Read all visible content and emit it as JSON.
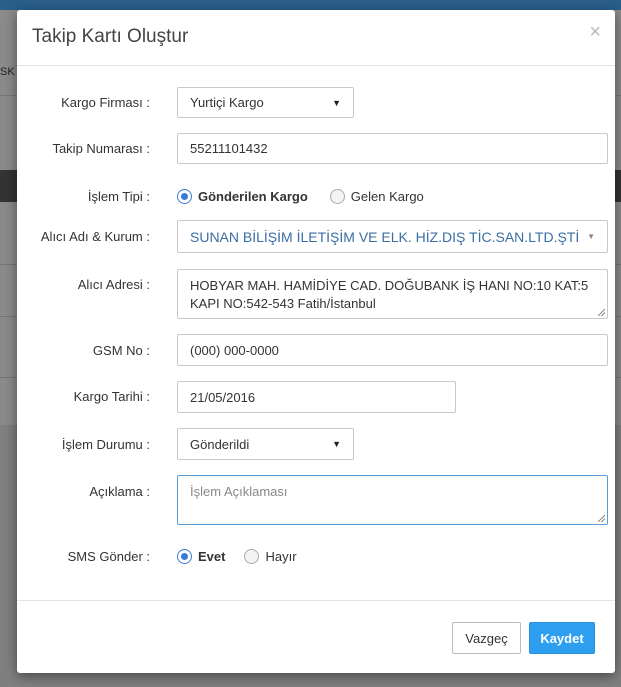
{
  "background": {
    "fragment_text": "SK"
  },
  "modal": {
    "title": "Takip Kartı Oluştur",
    "close_glyph": "×"
  },
  "form": {
    "cargo_company": {
      "label": "Kargo Firması :",
      "value": "Yurtiçi Kargo"
    },
    "tracking_number": {
      "label": "Takip Numarası :",
      "value": "55211101432"
    },
    "operation_type": {
      "label": "İşlem Tipi :",
      "options": [
        {
          "label": "Gönderilen Kargo",
          "selected": true
        },
        {
          "label": "Gelen Kargo",
          "selected": false
        }
      ]
    },
    "recipient": {
      "label": "Alıcı Adı & Kurum :",
      "value": "SUNAN BİLİŞİM İLETİŞİM VE ELK. HİZ.DIŞ TİC.SAN.LTD.ŞTİ"
    },
    "recipient_address": {
      "label": "Alıcı Adresi :",
      "line1": "HOBYAR MAH. HAMİDİYE CAD. DOĞUBANK İŞ HANI NO:10 KAT:5",
      "line2": "KAPI NO:542-543 Fatih/İstanbul"
    },
    "gsm": {
      "label": "GSM No :",
      "value": "(000) 000-0000"
    },
    "cargo_date": {
      "label": "Kargo Tarihi :",
      "value": "21/05/2016"
    },
    "status": {
      "label": "İşlem Durumu :",
      "value": "Gönderildi"
    },
    "description": {
      "label": "Açıklama :",
      "placeholder": "İşlem Açıklaması"
    },
    "sms": {
      "label": "SMS Gönder :",
      "options": [
        {
          "label": "Evet",
          "selected": true
        },
        {
          "label": "Hayır",
          "selected": false
        }
      ]
    }
  },
  "footer": {
    "cancel_label": "Vazgeç",
    "save_label": "Kaydet"
  },
  "colors": {
    "accent": "#2d9ef0",
    "radio": "#3a7bd5",
    "recipient_text": "#3a6ea5"
  }
}
